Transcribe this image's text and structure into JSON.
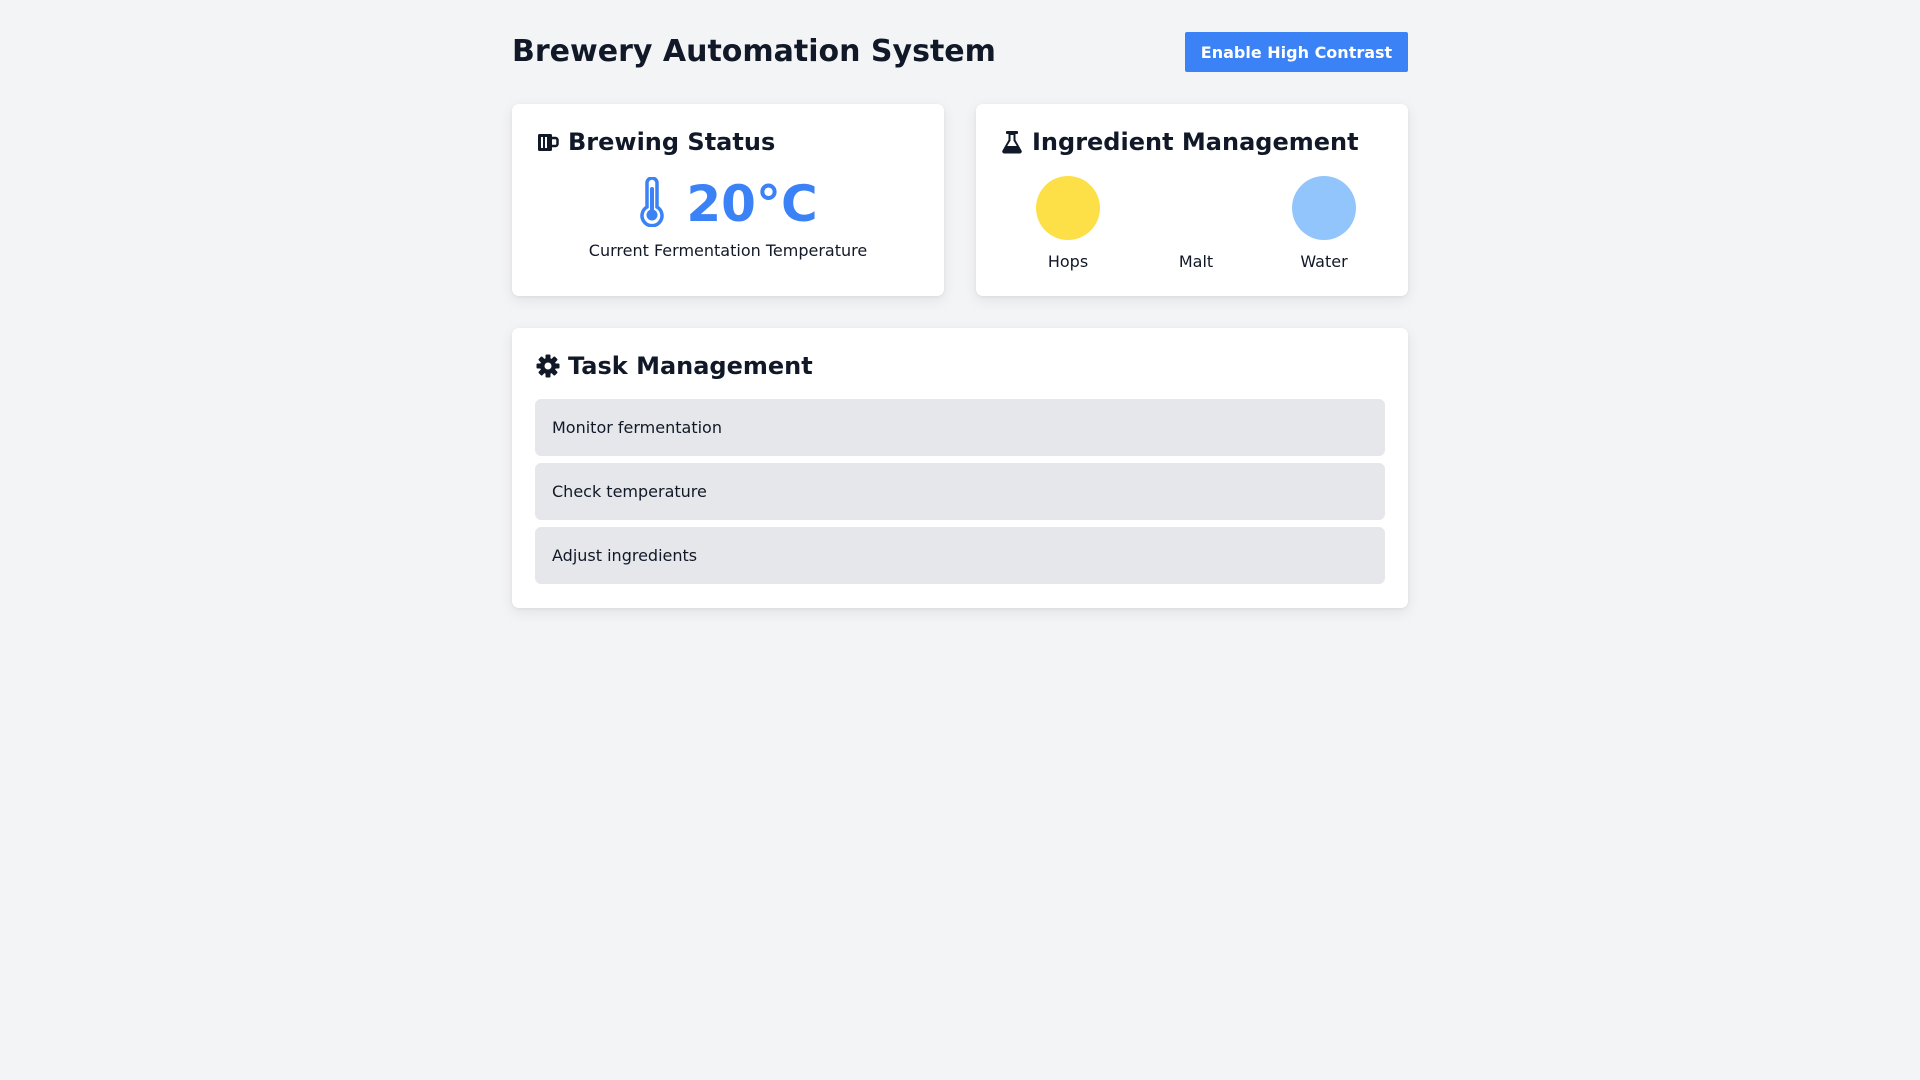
{
  "header": {
    "title": "Brewery Automation System",
    "contrast_button_label": "Enable High Contrast"
  },
  "brewing": {
    "title": "Brewing Status",
    "icon": "beer-mug-icon",
    "temperature": "20°C",
    "temperature_icon": "thermometer-icon",
    "caption": "Current Fermentation Temperature"
  },
  "ingredients": {
    "title": "Ingredient Management",
    "icon": "flask-icon",
    "items": [
      {
        "label": "Hops",
        "color": "#fde047"
      },
      {
        "label": "Malt",
        "color": "#ffffff"
      },
      {
        "label": "Water",
        "color": "#93c5fd"
      }
    ]
  },
  "tasks": {
    "title": "Task Management",
    "icon": "gear-icon",
    "items": [
      {
        "label": "Monitor fermentation"
      },
      {
        "label": "Check temperature"
      },
      {
        "label": "Adjust ingredients"
      }
    ]
  },
  "colors": {
    "accent": "#3b82f6",
    "background": "#f3f4f6",
    "task_background": "#e5e7eb"
  }
}
